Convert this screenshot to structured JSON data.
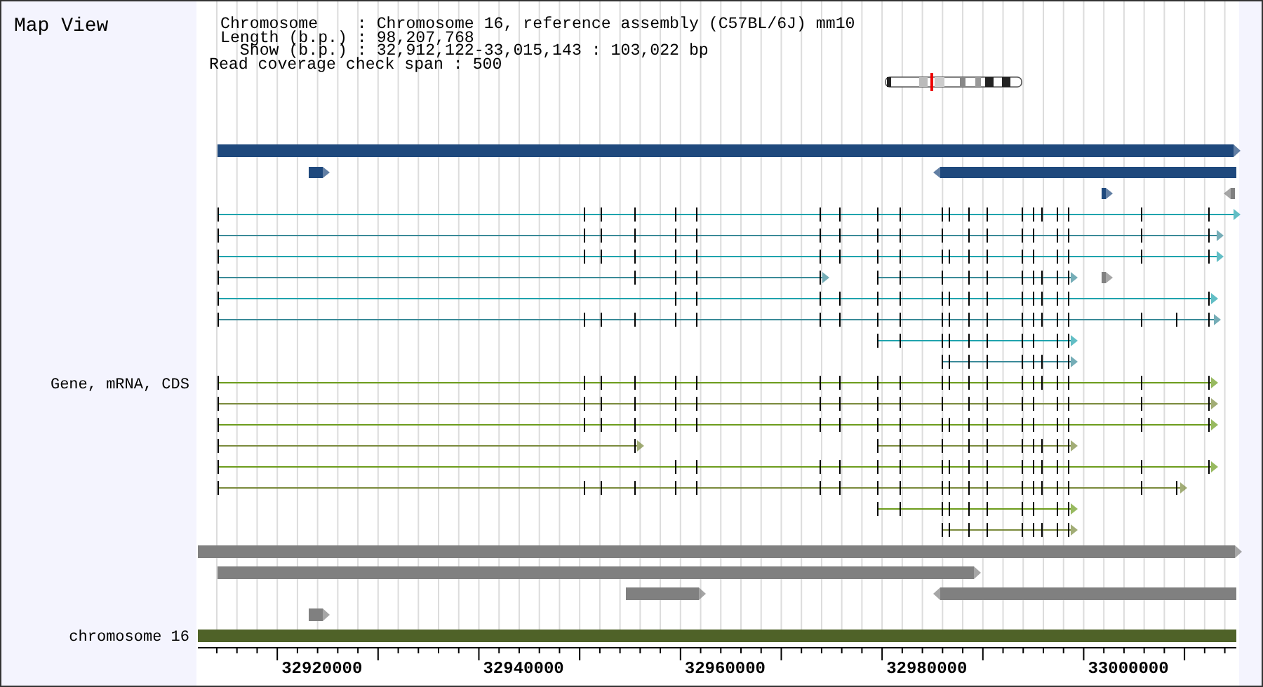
{
  "title": "Map View",
  "info_lines": [
    "Chromosome    : Chromosome 16, reference assembly (C57BL/6J) mm10",
    "Length (b.p.) : 98,207,768",
    "  Show (b.p.) : 32,912,122-33,015,143 : 103,022 bp"
  ],
  "coverage_line": "Read coverage check span : 500",
  "track_labels": [
    "Gene, mRNA, CDS",
    "chromosome 16"
  ],
  "axis": {
    "labels": [
      "32920000",
      "32940000",
      "32960000",
      "32980000",
      "33000000"
    ]
  }
}
